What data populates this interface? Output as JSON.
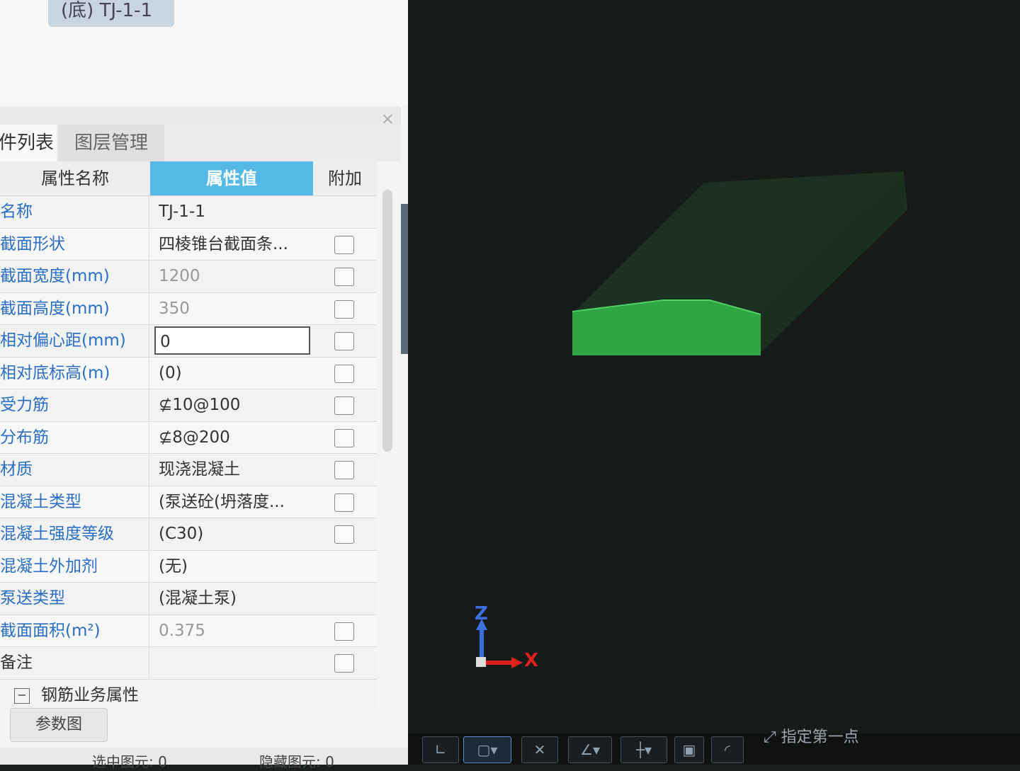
{
  "component_tag": "(底) TJ-1-1",
  "close_symbol": "×",
  "tabs": [
    "构件列表",
    "图层管理"
  ],
  "table": {
    "headers": [
      "属性名称",
      "属性值",
      "附加"
    ],
    "rows": [
      {
        "name": "名称",
        "value": "TJ-1-1"
      },
      {
        "name": "截面形状",
        "value": "四棱锥台截面条...",
        "checked": false
      },
      {
        "name": "截面宽度(mm)",
        "value": "1200",
        "checked": false
      },
      {
        "name": "截面高度(mm)",
        "value": "350",
        "checked": false
      },
      {
        "name": "相对偏心距(mm)",
        "value": "0",
        "checked": false
      },
      {
        "name": "相对底标高(m)",
        "value": "(0)",
        "checked": false
      },
      {
        "name": "受力筋",
        "value": "⊈10@100",
        "checked": false
      },
      {
        "name": "分布筋",
        "value": "⊈8@200",
        "checked": false
      },
      {
        "name": "材质",
        "value": "现浇混凝土",
        "checked": false
      },
      {
        "name": "混凝土类型",
        "value": "(泵送砼(坍落度...",
        "checked": false
      },
      {
        "name": "混凝土强度等级",
        "value": "(C30)",
        "checked": false
      },
      {
        "name": "混凝土外加剂",
        "value": "(无)"
      },
      {
        "name": "泵送类型",
        "value": "(混凝土泵)"
      },
      {
        "name": "截面面积(m²)",
        "value": "0.375",
        "checked": false
      },
      {
        "name": "备注",
        "value": "",
        "checked": false
      }
    ],
    "group_toggle": "−",
    "group_label": "钢筋业务属性"
  },
  "param_button": "参数图",
  "status": {
    "selected": "选中图元: 0",
    "hidden": "隐藏图元: 0"
  },
  "axis": {
    "z": "Z",
    "x": "X"
  },
  "prompt": "指定第一点",
  "colors": {
    "header_highlight": "#55b9e8",
    "link_text": "#2b6fc4",
    "model_green": "#34b24a",
    "viewport_bg": "#161a18"
  }
}
